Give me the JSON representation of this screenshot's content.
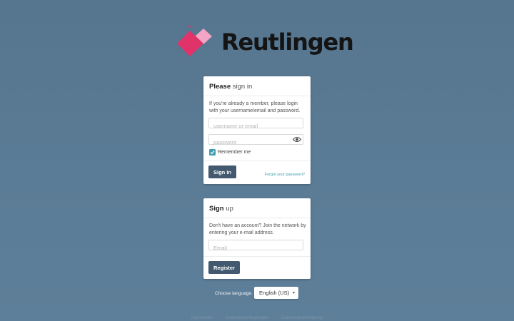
{
  "brand": {
    "name": "Reutlingen",
    "colors": {
      "primary": "#e0336a",
      "secondary": "#f2a5c4",
      "accent": "#c8255a"
    }
  },
  "signin": {
    "title_bold": "Please",
    "title_light": "sign in",
    "description": "If you're already a member, please login with your username/email and password.",
    "username_placeholder": "username or email",
    "password_placeholder": "password",
    "remember_label": "Remember me",
    "remember_checked": true,
    "button_label": "Sign in",
    "forgot_label": "Forgot your password?"
  },
  "signup": {
    "title_bold": "Sign",
    "title_light": "up",
    "description": "Don't have an account? Join the network by entering your e-mail address.",
    "email_placeholder": "Email",
    "button_label": "Register"
  },
  "language": {
    "label": "Choose language:",
    "selected": "English (US)"
  },
  "footer": {
    "links": [
      "Impressum",
      "Nutzungsbedingungen",
      "Datenschutzerklärung"
    ],
    "separator": "·"
  },
  "icons": {
    "eye": "eye-icon",
    "check": "check-icon",
    "caret": "chevron-down-icon"
  },
  "theme": {
    "button": "#43596f",
    "link": "#3f9fb0",
    "checkbox": "#3f9fb0"
  }
}
